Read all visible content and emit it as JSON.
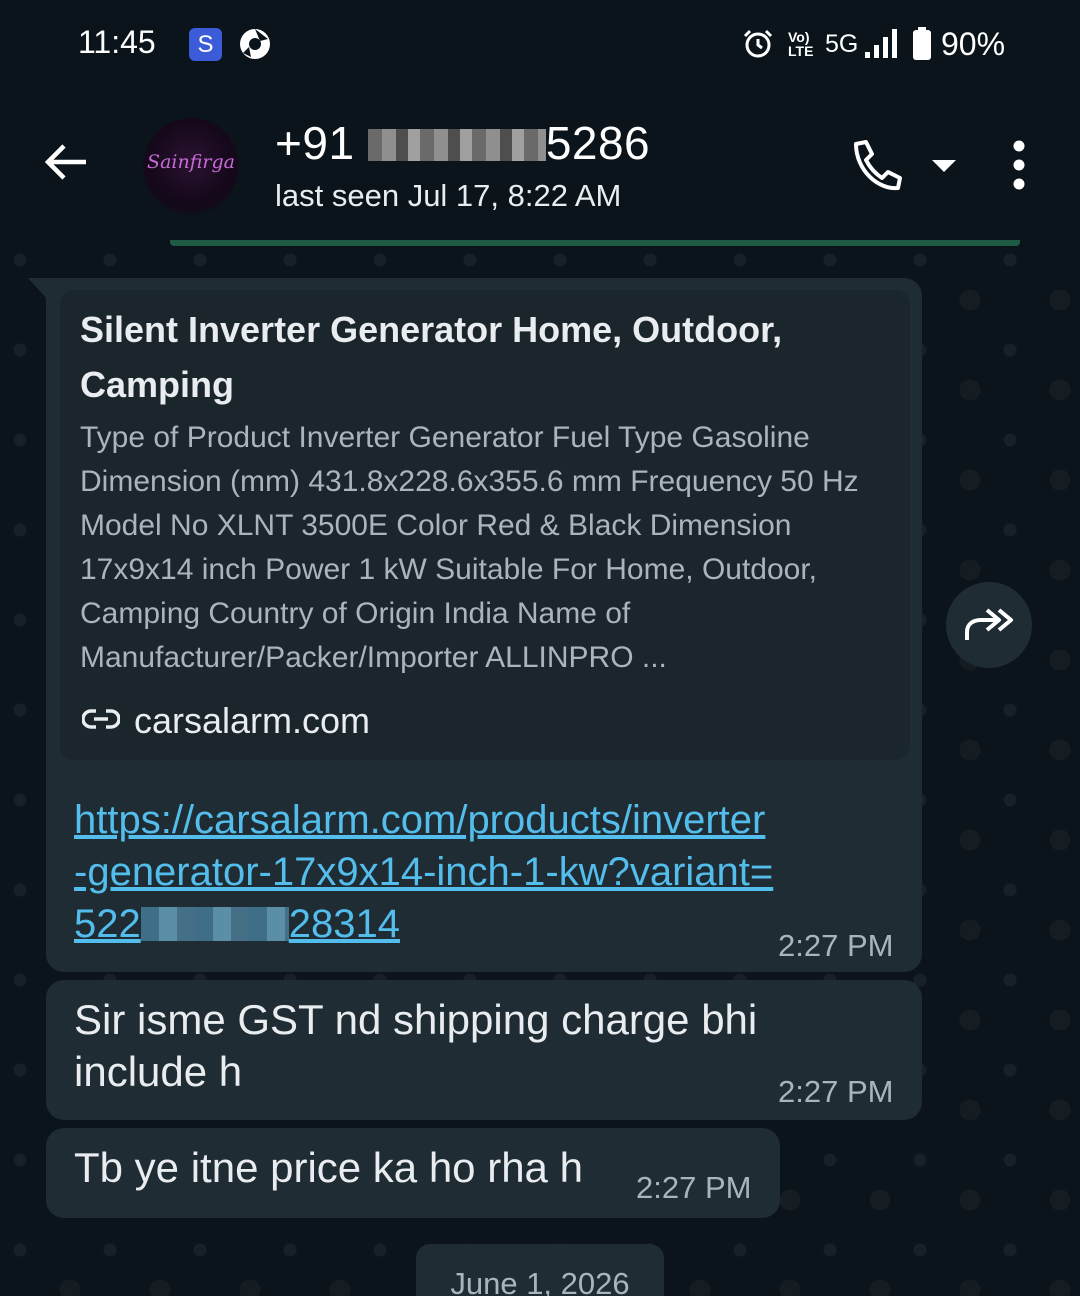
{
  "status_bar": {
    "time": "11:45",
    "s_badge": "S",
    "network_label": "5G",
    "volte_label": "Vo) LTE",
    "battery": "90%",
    "icons": [
      "chrome-icon",
      "alarm-icon",
      "signal-icon",
      "battery-icon"
    ]
  },
  "header": {
    "contact_prefix": "+91",
    "contact_suffix": "5286",
    "avatar_text": "Sainfirga",
    "last_seen": "last seen Jul 17, 8:22 AM",
    "icons": [
      "back-arrow-icon",
      "phone-icon",
      "dropdown-icon",
      "more-vert-icon"
    ]
  },
  "messages": [
    {
      "preview_title": "Silent Inverter Generator Home, Outdoor, Camping",
      "preview_description": "Type of Product Inverter Generator Fuel Type Gasoline Dimension (mm) 431.8x228.6x355.6 mm Frequency 50 Hz Model No XLNT 3500E Color Red & Black Dimension 17x9x14 inch Power 1 kW Suitable For Home, Outdoor, Camping Country of Origin India Name of Manufacturer/Packer/Importer ALLINPRO ...",
      "preview_domain": "carsalarm.com",
      "url_line1": "https://carsalarm.com/products/inverter",
      "url_line2": "-generator-17x9x14-inch-1-kw?variant=",
      "url_line3_prefix": "522",
      "url_line3_suffix": "28314",
      "time": "2:27 PM"
    },
    {
      "text": "Sir isme GST nd shipping charge bhi include h",
      "time": "2:27 PM"
    },
    {
      "text": "Tb ye itne price ka ho rha h",
      "time": "2:27 PM"
    }
  ],
  "date_separator": "June 1, 2026",
  "colors": {
    "background": "#0b141a",
    "bubble": "#1f2c34",
    "link": "#53bdeb",
    "secondary_text": "#aab4bb"
  }
}
